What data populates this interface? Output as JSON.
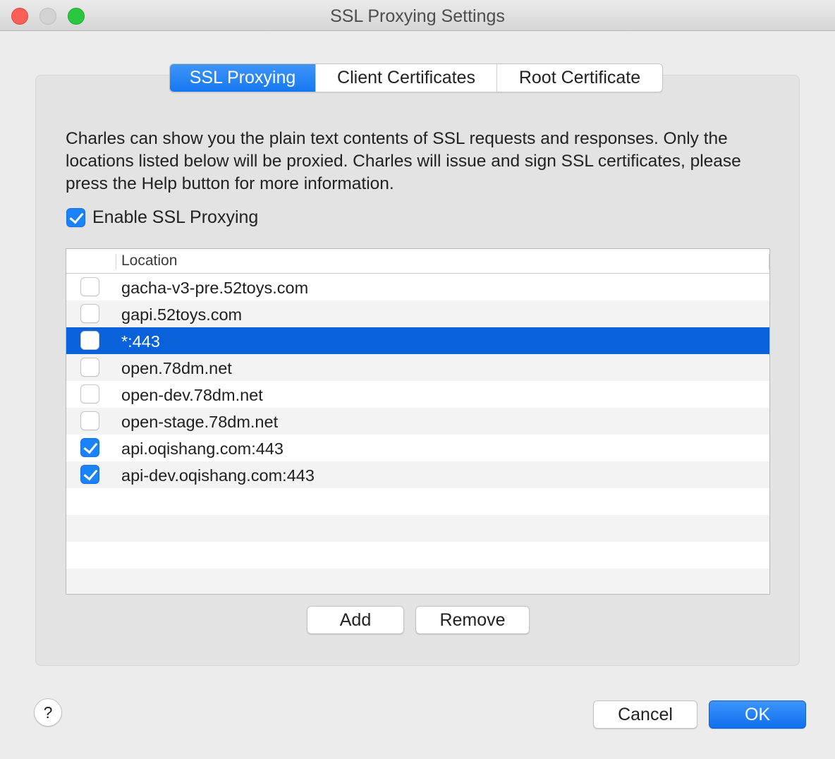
{
  "window": {
    "title": "SSL Proxying Settings"
  },
  "tabs": [
    {
      "label": "SSL Proxying",
      "active": true
    },
    {
      "label": "Client Certificates",
      "active": false
    },
    {
      "label": "Root Certificate",
      "active": false
    }
  ],
  "description": "Charles can show you the plain text contents of SSL requests and responses. Only the locations listed below will be proxied. Charles will issue and sign SSL certificates, please press the Help button for more information.",
  "enable": {
    "label": "Enable SSL Proxying",
    "checked": true
  },
  "table": {
    "column_header": "Location",
    "rows": [
      {
        "location": "gacha-v3-pre.52toys.com",
        "checked": false,
        "selected": false
      },
      {
        "location": "gapi.52toys.com",
        "checked": false,
        "selected": false
      },
      {
        "location": " *:443",
        "checked": false,
        "selected": true
      },
      {
        "location": "open.78dm.net",
        "checked": false,
        "selected": false
      },
      {
        "location": "open-dev.78dm.net",
        "checked": false,
        "selected": false
      },
      {
        "location": "open-stage.78dm.net",
        "checked": false,
        "selected": false
      },
      {
        "location": "api.oqishang.com:443",
        "checked": true,
        "selected": false
      },
      {
        "location": "api-dev.oqishang.com:443",
        "checked": true,
        "selected": false
      }
    ]
  },
  "buttons": {
    "add": "Add",
    "remove": "Remove",
    "cancel": "Cancel",
    "ok": "OK",
    "help": "?"
  },
  "colors": {
    "accent": "#1a82fb",
    "selection": "#0a62da",
    "close": "#fc5f57",
    "zoom": "#2ac840"
  }
}
